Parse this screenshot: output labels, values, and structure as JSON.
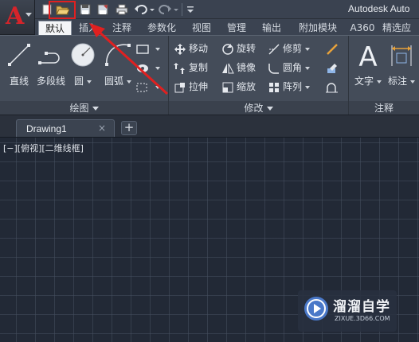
{
  "title_bar": {
    "title": "Autodesk Auto",
    "app_logo_letter": "A",
    "qat_icons": [
      "new-icon",
      "open-icon",
      "save-icon",
      "save-as-icon",
      "print-icon",
      "undo-icon",
      "redo-icon",
      "customize-icon"
    ]
  },
  "ribbon_tabs": [
    {
      "label": "默认",
      "active": true
    },
    {
      "label": "插入",
      "active": false
    },
    {
      "label": "注释",
      "active": false
    },
    {
      "label": "参数化",
      "active": false
    },
    {
      "label": "视图",
      "active": false
    },
    {
      "label": "管理",
      "active": false
    },
    {
      "label": "输出",
      "active": false
    },
    {
      "label": "附加模块",
      "active": false
    },
    {
      "label": "A360",
      "active": false
    },
    {
      "label": "精选应",
      "active": false
    }
  ],
  "panels": {
    "draw": {
      "title": "绘图",
      "tools": [
        {
          "label": "直线",
          "icon": "line-icon"
        },
        {
          "label": "多段线",
          "icon": "polyline-icon"
        },
        {
          "label": "圆",
          "icon": "circle-icon"
        },
        {
          "label": "圆弧",
          "icon": "arc-icon"
        }
      ]
    },
    "modify": {
      "title": "修改",
      "tools": [
        {
          "label": "移动",
          "icon": "move-icon"
        },
        {
          "label": "旋转",
          "icon": "rotate-icon"
        },
        {
          "label": "修剪",
          "icon": "trim-icon"
        },
        {
          "label": "复制",
          "icon": "copy-icon"
        },
        {
          "label": "镜像",
          "icon": "mirror-icon"
        },
        {
          "label": "圆角",
          "icon": "fillet-icon"
        },
        {
          "label": "拉伸",
          "icon": "stretch-icon"
        },
        {
          "label": "缩放",
          "icon": "scale-icon"
        },
        {
          "label": "阵列",
          "icon": "array-icon"
        }
      ]
    },
    "annotation": {
      "title": "注释",
      "tools": [
        {
          "label": "文字",
          "icon": "text-icon"
        },
        {
          "label": "标注",
          "icon": "dimension-icon"
        }
      ]
    }
  },
  "file_tabs": [
    {
      "label": "Drawing1",
      "close": "×"
    }
  ],
  "new_tab_symbol": "+",
  "viewport_label": "[−][俯视][二维线框]",
  "watermark": {
    "main": "溜溜自学",
    "sub": "ZIXUE.3D66.COM"
  },
  "colors": {
    "accent_red": "#e02020",
    "canvas_bg": "#222936",
    "ribbon_bg": "#444c59"
  }
}
